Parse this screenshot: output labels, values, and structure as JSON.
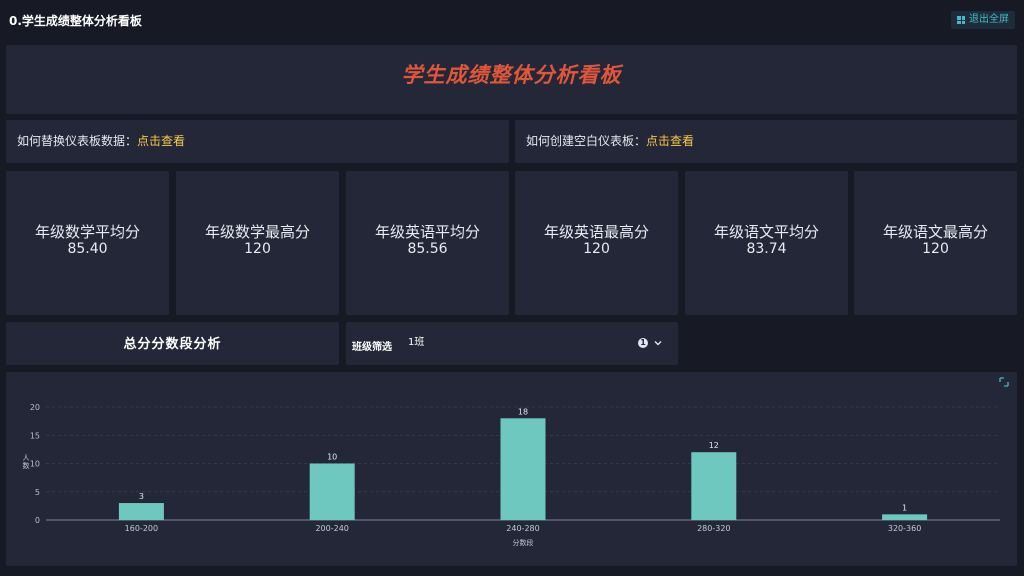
{
  "topbar": {
    "title": "0.学生成绩整体分析看板",
    "exit_fullscreen": "退出全屏"
  },
  "banner": {
    "title": "学生成绩整体分析看板"
  },
  "help_links": [
    {
      "prefix": "如何替换仪表板数据：",
      "link": "点击查看"
    },
    {
      "prefix": "如何创建空白仪表板：",
      "link": "点击查看"
    }
  ],
  "kpis": [
    {
      "label": "年级数学平均分",
      "value": "85.40"
    },
    {
      "label": "年级数学最高分",
      "value": "120"
    },
    {
      "label": "年级英语平均分",
      "value": "85.56"
    },
    {
      "label": "年级英语最高分",
      "value": "120"
    },
    {
      "label": "年级语文平均分",
      "value": "83.74"
    },
    {
      "label": "年级语文最高分",
      "value": "120"
    }
  ],
  "section": {
    "title": "总分分数段分析"
  },
  "filter": {
    "label": "班级筛选",
    "value": "1班",
    "info": "1"
  },
  "colors": {
    "bar": "#6fc8bf",
    "accent_title": "#e0563b",
    "link": "#f7c948"
  },
  "chart_data": {
    "type": "bar",
    "categories": [
      "160-200",
      "200-240",
      "240-280",
      "280-320",
      "320-360"
    ],
    "values": [
      3,
      10,
      18,
      12,
      1
    ],
    "xlabel": "分数段",
    "ylabel": "人数",
    "ylim": [
      0,
      20
    ],
    "yticks": [
      0,
      5,
      10,
      15,
      20
    ],
    "grid": true
  }
}
